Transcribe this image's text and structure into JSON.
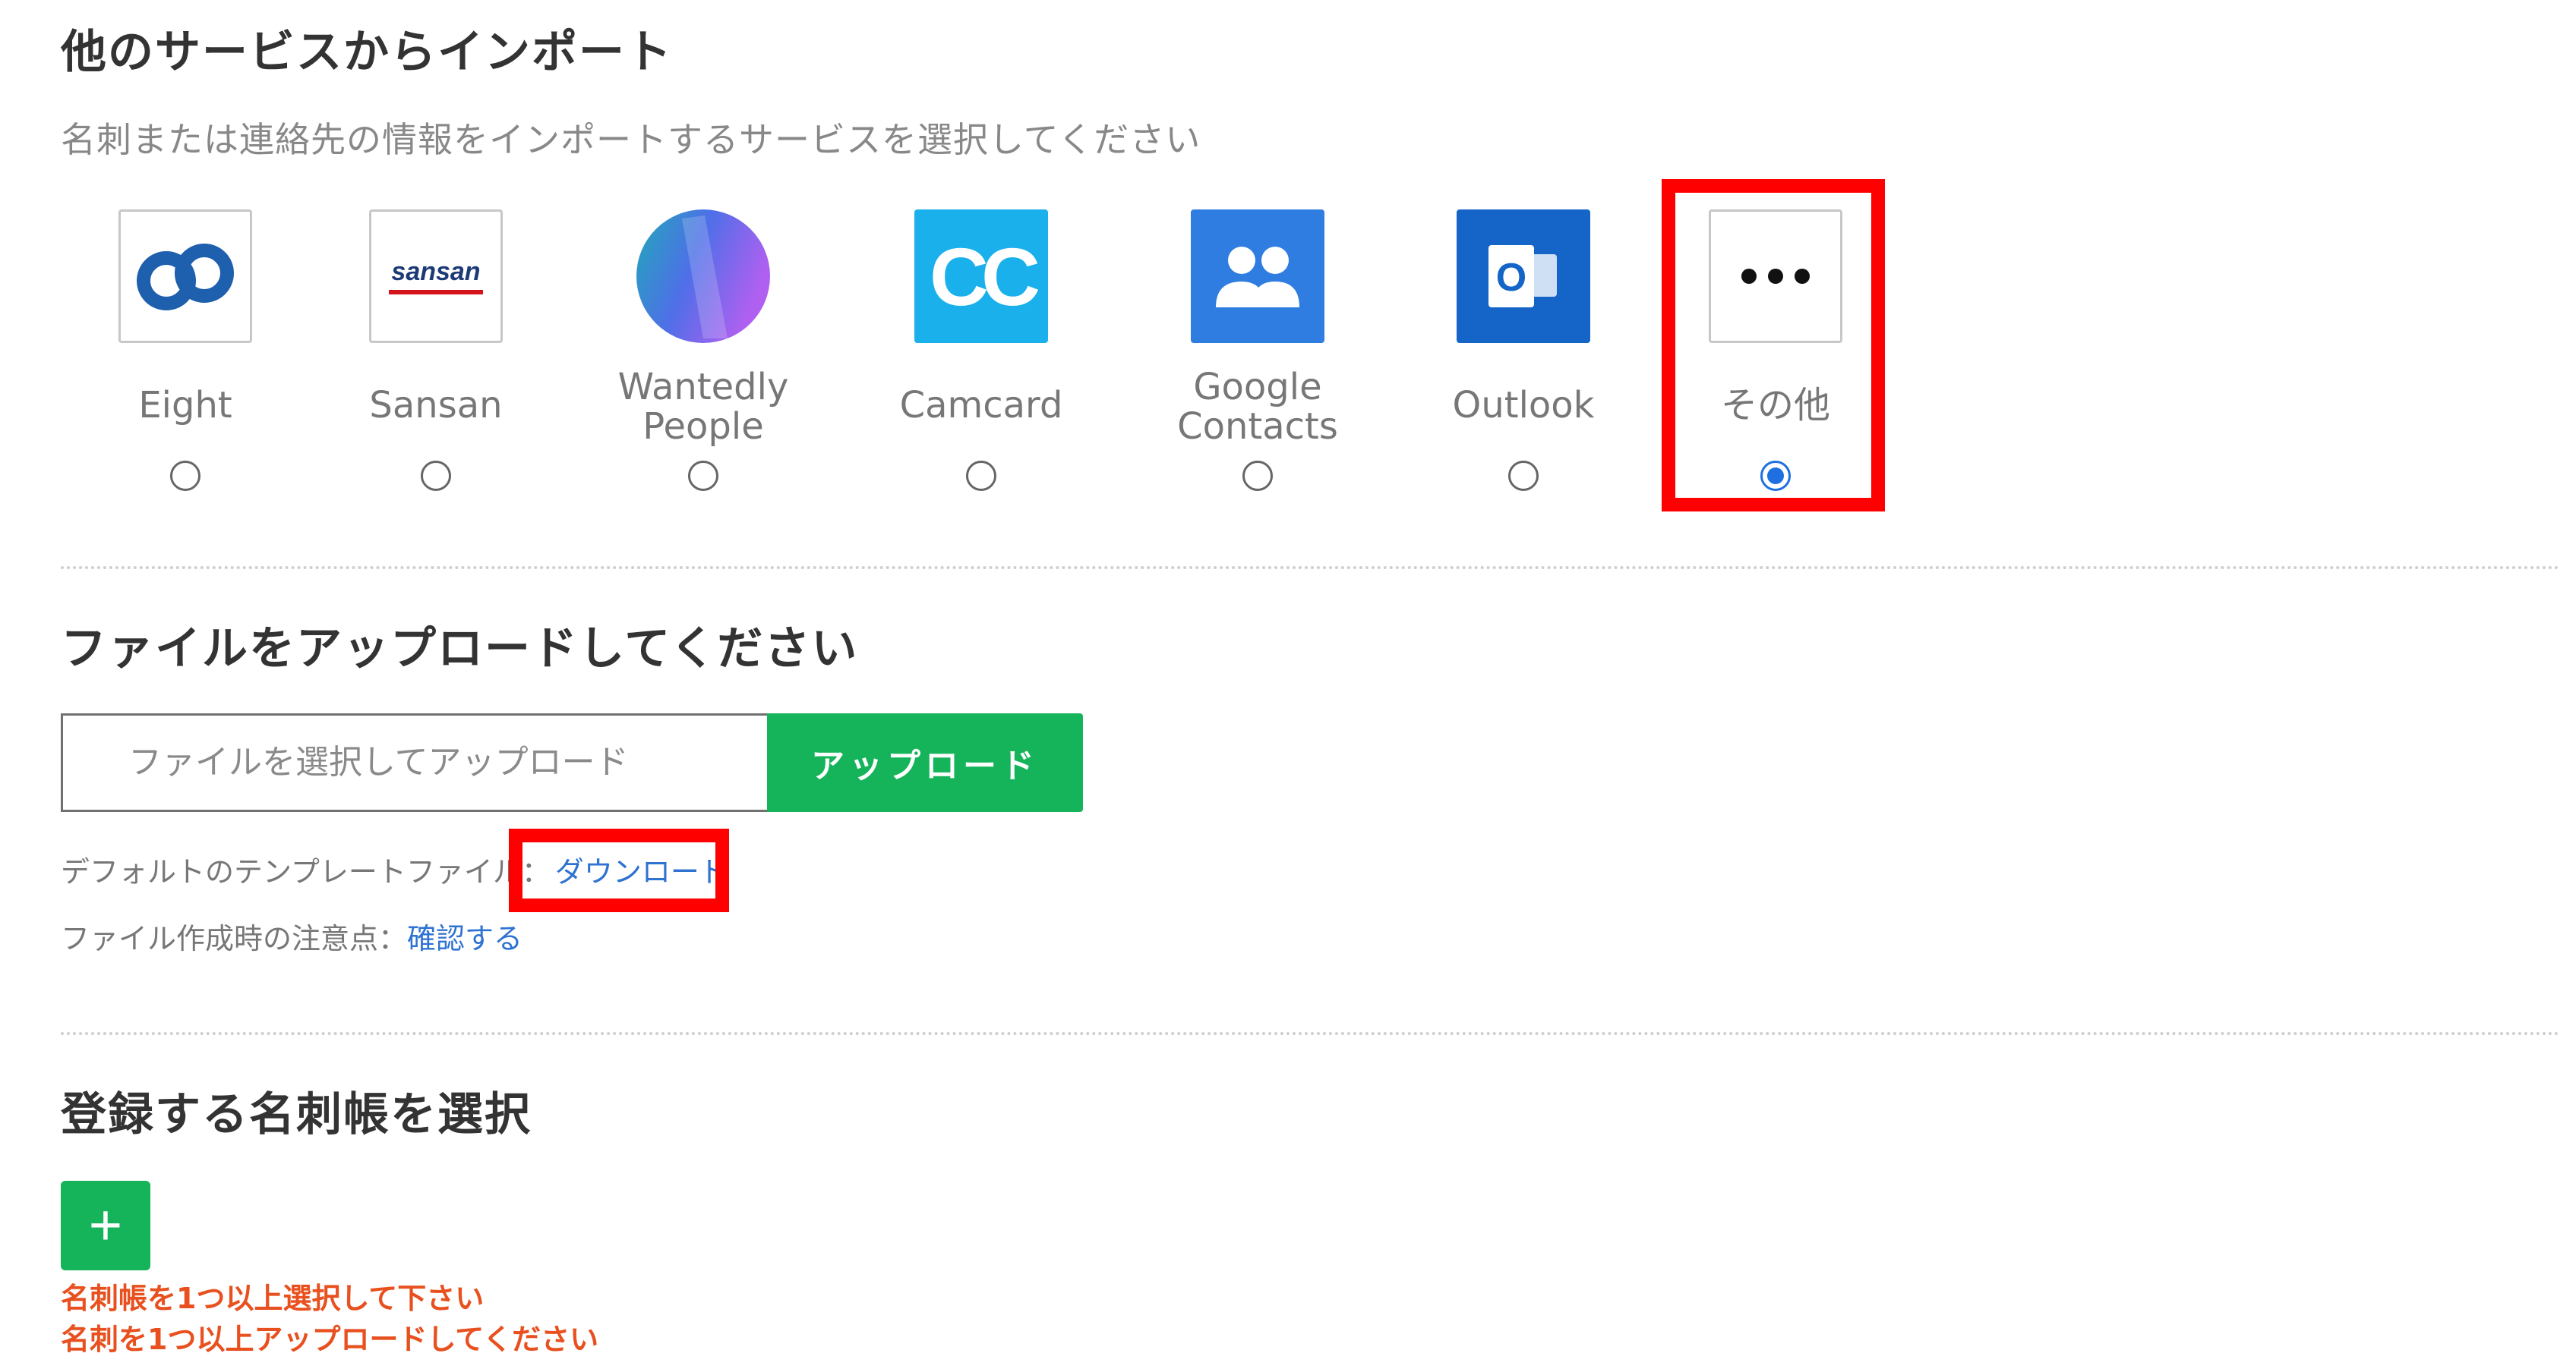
{
  "import_section": {
    "title": "他のサービスからインポート",
    "subtitle": "名刺または連絡先の情報をインポートするサービスを選択してください"
  },
  "services": [
    {
      "id": "eight",
      "label": "Eight",
      "selected": false
    },
    {
      "id": "sansan",
      "label": "Sansan",
      "logo_text": "sansan",
      "selected": false
    },
    {
      "id": "wantedly",
      "label_line1": "Wantedly",
      "label_line2": "People",
      "selected": false
    },
    {
      "id": "camcard",
      "label": "Camcard",
      "logo_text": "CC",
      "selected": false
    },
    {
      "id": "google",
      "label_line1": "Google",
      "label_line2": "Contacts",
      "selected": false
    },
    {
      "id": "outlook",
      "label": "Outlook",
      "logo_text": "O",
      "selected": false
    },
    {
      "id": "other",
      "label": "その他",
      "selected": true
    }
  ],
  "upload_section": {
    "title": "ファイルをアップロードしてください",
    "file_placeholder": "ファイルを選択してアップロード",
    "upload_button": "アップロード",
    "template_label": "デフォルトのテンプレートファイル：",
    "template_link": "ダウンロード",
    "notes_label": "ファイル作成時の注意点：",
    "notes_link": "確認する"
  },
  "register_section": {
    "title": "登録する名刺帳を選択",
    "add_button": "+",
    "errors": [
      "名刺帳を1つ以上選択して下さい",
      "名刺を1つ以上アップロードしてください"
    ]
  },
  "colors": {
    "accent_green": "#16b45a",
    "link_blue": "#2e72d2",
    "error_orange": "#e8511f",
    "highlight_red": "#ff0000",
    "radio_blue": "#1e6fe0"
  },
  "icons": [
    "eight-logo-icon",
    "sansan-logo-icon",
    "wantedly-logo-icon",
    "camcard-logo-icon",
    "google-contacts-icon",
    "outlook-logo-icon",
    "more-icon"
  ]
}
